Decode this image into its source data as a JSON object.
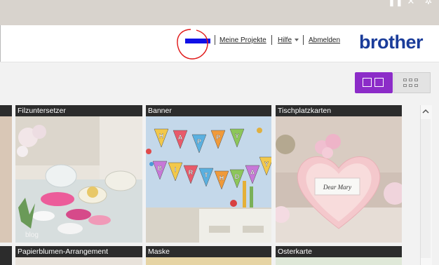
{
  "window": {
    "buttons": [
      "pause-icon",
      "close-icon",
      "settings-icon"
    ]
  },
  "header": {
    "nav": [
      {
        "label": "Meine Projekte"
      },
      {
        "label": "Hilfe"
      },
      {
        "label": "Abmelden"
      }
    ],
    "logo_text": "brother",
    "logo_color": "#1a3c9a"
  },
  "view_toggle": {
    "active": "large",
    "accent": "#8c2cc8"
  },
  "cards": [
    {
      "title": "Filzuntersetzer",
      "overlay": "blog"
    },
    {
      "title": "Banner"
    },
    {
      "title": "Tischplatzkarten",
      "card_text": "Dear Mary"
    },
    {
      "title": "Papierblumen-Arrangement"
    },
    {
      "title": "Maske"
    },
    {
      "title": "Osterkarte"
    }
  ],
  "banner_letters": [
    "H",
    "A",
    "P",
    "P",
    "Y",
    "B",
    "I",
    "R",
    "T",
    "H",
    "D",
    "A",
    "Y"
  ]
}
